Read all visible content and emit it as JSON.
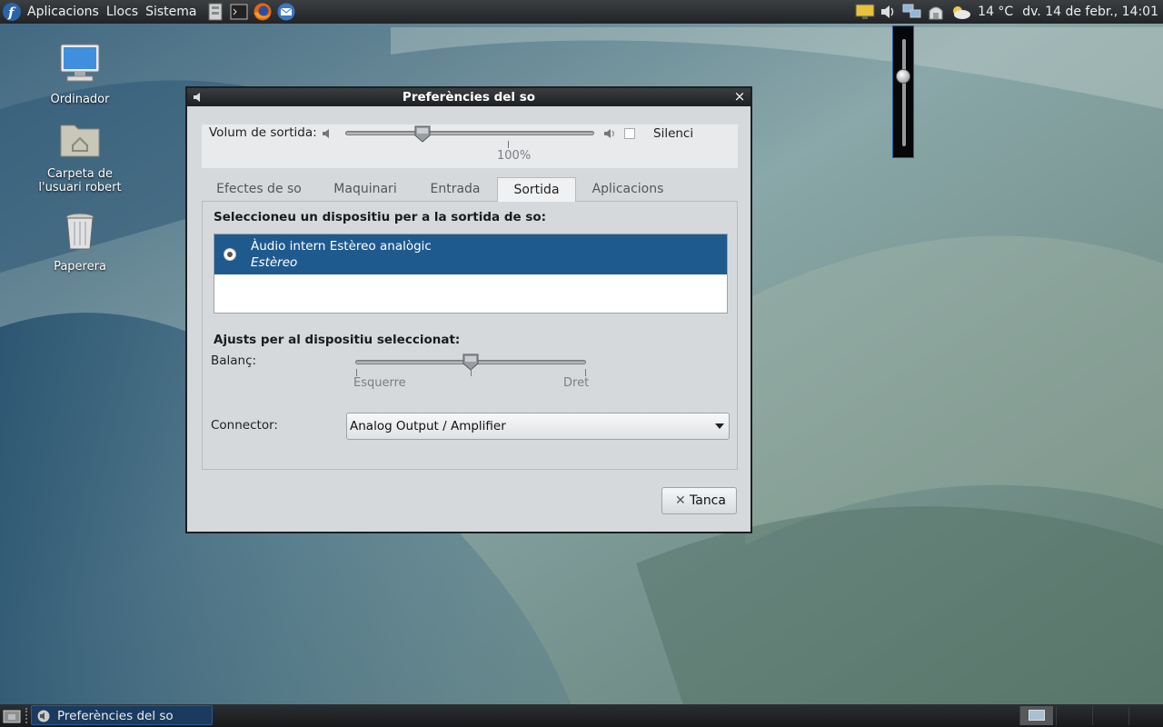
{
  "top_panel": {
    "menus": [
      "Aplicacions",
      "Llocs",
      "Sistema"
    ],
    "weather": "14 °C",
    "clock": "dv. 14 de febr., 14:01"
  },
  "desktop": {
    "icons": [
      {
        "label": "Ordinador"
      },
      {
        "label": "Carpeta de l'usuari robert"
      },
      {
        "label": "Paperera"
      }
    ]
  },
  "system_volume": {
    "level_percent": 65
  },
  "window": {
    "title": "Preferències del so",
    "volume": {
      "label": "Volum de sortida:",
      "level_percent": 31,
      "mark_label": "100%",
      "mute_label": "Silenci",
      "muted": false
    },
    "tabs": [
      {
        "label": "Efectes de so"
      },
      {
        "label": "Maquinari"
      },
      {
        "label": "Entrada"
      },
      {
        "label": "Sortida",
        "active": true
      },
      {
        "label": "Aplicacions"
      }
    ],
    "output": {
      "select_label": "Seleccioneu un dispositiu per a la sortida de so:",
      "devices": [
        {
          "name": "Àudio intern Estèreo analògic",
          "subtitle": "Estèreo",
          "selected": true
        }
      ],
      "settings_label": "Ajusts per al dispositiu seleccionat:",
      "balance_label": "Balanç:",
      "balance_left": "Esquerre",
      "balance_right": "Dret",
      "balance_value": 0.5,
      "connector_label": "Connector:",
      "connector_value": "Analog Output / Amplifier"
    },
    "close_button": "Tanca"
  },
  "taskbar": {
    "task": "Preferències del so"
  }
}
